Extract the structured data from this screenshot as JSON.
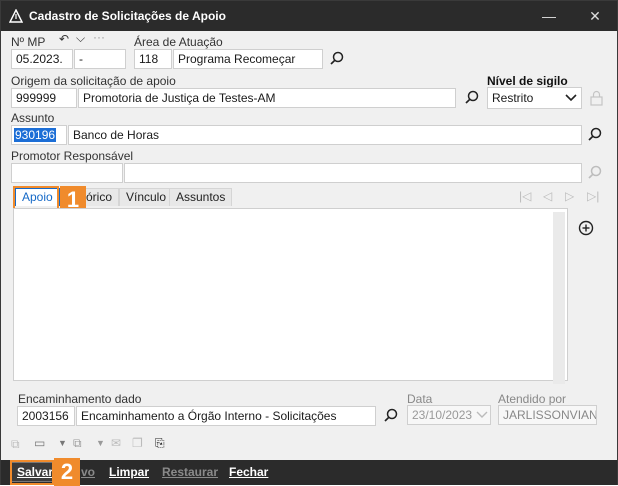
{
  "window": {
    "title": "Cadastro de Solicitações de Apoio",
    "icon": "warning-triangle-icon",
    "controls": [
      "minimize-icon",
      "close-icon"
    ]
  },
  "header": {
    "np_label": "Nº MP",
    "np_value_1": "05.2023.",
    "np_value_2": "-",
    "area_label": "Área de Atuação",
    "area_code": "118",
    "area_name": "Programa Recomeçar"
  },
  "origem": {
    "label": "Origem da solicitação de apoio",
    "code": "999999",
    "name": "Promotoria de Justiça de Testes-AM"
  },
  "sigilo": {
    "label": "Nível de sigilo",
    "selected": "Restrito"
  },
  "assunto": {
    "label": "Assunto",
    "code": "930196",
    "name": "Banco de Horas"
  },
  "promotor": {
    "label": "Promotor Responsável",
    "code": "",
    "name": ""
  },
  "tabs": [
    {
      "label": "Apoio",
      "active": true
    },
    {
      "label": "Histórico",
      "visible_fragment": "órico"
    },
    {
      "label": "Vínculo"
    },
    {
      "label": "Assuntos"
    }
  ],
  "encaminhamento": {
    "label": "Encaminhamento dado",
    "code": "2003156",
    "name": "Encaminhamento a Órgão Interno - Solicitações"
  },
  "data": {
    "label": "Data",
    "value": "23/10/2023"
  },
  "atendido": {
    "label": "Atendido por",
    "value": "JARLISSONVIANA"
  },
  "badges": {
    "one": "1",
    "two": "2"
  },
  "actions": {
    "salvar": "Salvar",
    "novo_fragment": "vo",
    "limpar": "Limpar",
    "restaurar": "Restaurar",
    "fechar": "Fechar"
  },
  "colors": {
    "accent_orange": "#f08b2c",
    "tab_blue": "#1569c7",
    "titlebar": "#2b2b2b"
  }
}
